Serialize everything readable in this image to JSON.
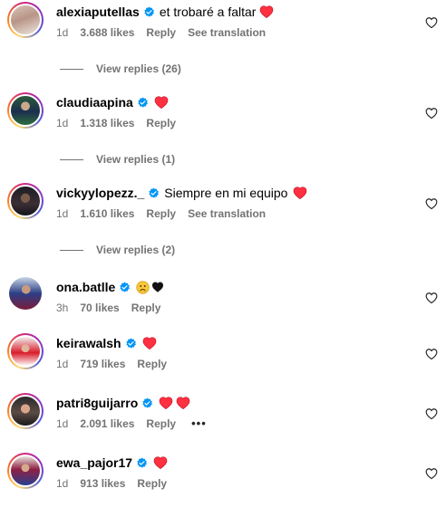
{
  "comments": [
    {
      "username": "alexiaputellas",
      "text": "et trobaré a faltar",
      "emoji": "heart",
      "time": "1d",
      "likes": "3.688 likes",
      "reply": "Reply",
      "translate": "See translation",
      "view_replies": "View replies (26)"
    },
    {
      "username": "claudiaapina",
      "text": "",
      "emoji": "heart",
      "time": "1d",
      "likes": "1.318 likes",
      "reply": "Reply",
      "view_replies": "View replies (1)"
    },
    {
      "username": "vickyylopezz._",
      "text": "Siempre en mi equipo",
      "emoji": "heart",
      "time": "1d",
      "likes": "1.610 likes",
      "reply": "Reply",
      "translate": "See translation",
      "view_replies": "View replies (2)"
    },
    {
      "username": "ona.batlle",
      "text": "",
      "emoji": "sad-face black-heart",
      "time": "3h",
      "likes": "70 likes",
      "reply": "Reply"
    },
    {
      "username": "keirawalsh",
      "text": "",
      "emoji": "heart",
      "time": "1d",
      "likes": "719 likes",
      "reply": "Reply"
    },
    {
      "username": "patri8guijarro",
      "text": "",
      "emoji": "heart heart",
      "time": "1d",
      "likes": "2.091 likes",
      "reply": "Reply",
      "more": "•••"
    },
    {
      "username": "ewa_pajor17",
      "text": "",
      "emoji": "heart",
      "time": "1d",
      "likes": "913 likes",
      "reply": "Reply"
    }
  ],
  "colors": {
    "verified": "#0095f6",
    "heart": "#ff3040",
    "meta": "#737373"
  },
  "icons": {
    "verified": "verified-badge-icon",
    "like": "heart-outline-icon"
  }
}
